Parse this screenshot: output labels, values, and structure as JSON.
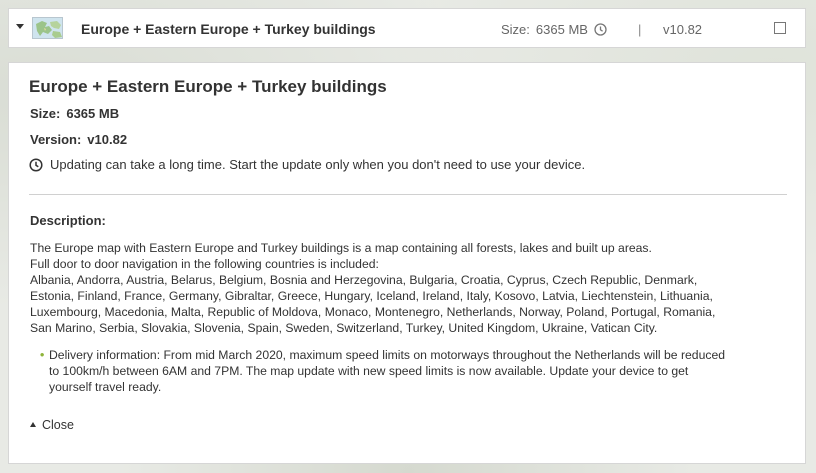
{
  "header": {
    "title": "Europe + Eastern Europe + Turkey buildings",
    "size_label": "Size:",
    "size_value": "6365 MB",
    "separator": "|",
    "version": "v10.82"
  },
  "details": {
    "title": "Europe + Eastern Europe + Turkey buildings",
    "size_label": "Size:",
    "size_value": "6365 MB",
    "version_label": "Version:",
    "version_value": "v10.82",
    "note": "Updating can take a long time. Start the update only when you don't need to use your device.",
    "description_heading": "Description:",
    "description_lines": [
      "The Europe map with Eastern Europe and Turkey buildings is a map containing all forests, lakes and built up areas.",
      "Full door to door navigation in the following countries is included:",
      "Albania, Andorra, Austria, Belarus, Belgium, Bosnia and Herzegovina, Bulgaria, Croatia, Cyprus, Czech Republic, Denmark,",
      "Estonia, Finland, France, Germany, Gibraltar, Greece, Hungary, Iceland, Ireland, Italy, Kosovo, Latvia, Liechtenstein, Lithuania,",
      "Luxembourg, Macedonia, Malta, Republic of Moldova, Monaco, Montenegro, Netherlands, Norway, Poland, Portugal, Romania,",
      "San Marino, Serbia, Slovakia, Slovenia, Spain, Sweden, Switzerland, Turkey, United Kingdom, Ukraine, Vatican City."
    ],
    "bullet_lines": [
      "Delivery information: From mid March 2020, maximum speed limits on motorways throughout the Netherlands will be reduced",
      "to 100km/h between 6AM and 7PM. The map update with new speed limits is now available. Update your device to get",
      "yourself travel ready."
    ],
    "close_label": "Close"
  },
  "colors": {
    "bullet": "#8fb43a",
    "panel_bg": "#ffffff",
    "border": "#d6d6d6"
  },
  "icons": [
    "chevron-down-icon",
    "map-thumbnail",
    "clock-icon",
    "checkbox",
    "chevron-up-icon"
  ]
}
